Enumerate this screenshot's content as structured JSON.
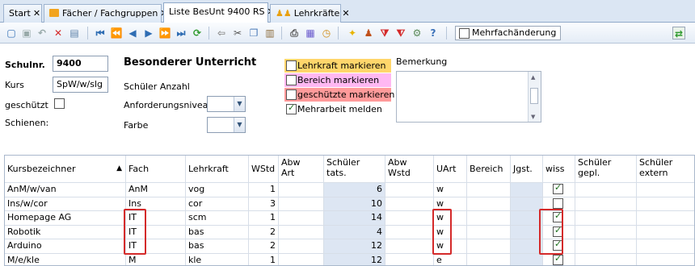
{
  "tabs": [
    {
      "label": "Start"
    },
    {
      "label": "Fächer / Fachgruppen"
    },
    {
      "label": "Liste BesUnt 9400 RS"
    },
    {
      "label": "Lehrkräfte"
    }
  ],
  "toolbar": {
    "mehrfach_label": "Mehrfachänderung"
  },
  "form": {
    "schulnr_label": "Schulnr.",
    "schulnr_value": "9400",
    "kurs_label": "Kurs",
    "kurs_value": "SpW/w/slg",
    "geschuetzt_label": "geschützt",
    "schienen_label": "Schienen:",
    "title": "Besonderer Unterricht",
    "schueler_anzahl_label": "Schüler Anzahl",
    "anforderung_label": "Anforderungsniveau",
    "farbe_label": "Farbe",
    "lehrkraft_markieren": "Lehrkraft markieren",
    "bereich_markieren": "Bereich markieren",
    "geschuetzte_markieren": "geschützte markieren",
    "mehrarbeit_melden": "Mehrarbeit melden",
    "bemerkung_label": "Bemerkung",
    "colors": {
      "lehrkraft": "#ffd66b",
      "bereich": "#ffb8f2",
      "geschuetzt": "#ff9a9a"
    }
  },
  "table": {
    "headers": {
      "kurs": "Kursbezeichner",
      "fach": "Fach",
      "lehrkraft": "Lehrkraft",
      "wstd": "WStd",
      "abwart1": "Abw",
      "abwart2": "Art",
      "schueler1": "Schüler",
      "schueler2": "tats.",
      "abwwstd1": "Abw",
      "abwwstd2": "Wstd",
      "uart": "UArt",
      "bereich": "Bereich",
      "jgst": "Jgst.",
      "wiss": "wiss",
      "gepl1": "Schüler",
      "gepl2": "gepl.",
      "extern1": "Schüler",
      "extern2": "extern"
    },
    "rows": [
      {
        "kurs": "AnM/w/van",
        "fach": "AnM",
        "lehrkraft": "vog",
        "wstd": "1",
        "schueler": "6",
        "uart": "w",
        "wiss": true
      },
      {
        "kurs": "Ins/w/cor",
        "fach": "Ins",
        "lehrkraft": "cor",
        "wstd": "3",
        "schueler": "10",
        "uart": "w",
        "wiss": false
      },
      {
        "kurs": "Homepage AG",
        "fach": "IT",
        "lehrkraft": "scm",
        "wstd": "1",
        "schueler": "14",
        "uart": "w",
        "wiss": true
      },
      {
        "kurs": "Robotik",
        "fach": "IT",
        "lehrkraft": "bas",
        "wstd": "2",
        "schueler": "4",
        "uart": "w",
        "wiss": true
      },
      {
        "kurs": "Arduino",
        "fach": "IT",
        "lehrkraft": "bas",
        "wstd": "2",
        "schueler": "12",
        "uart": "w",
        "wiss": true
      },
      {
        "kurs": "M/e/kle",
        "fach": "M",
        "lehrkraft": "kle",
        "wstd": "1",
        "schueler": "12",
        "uart": "e",
        "wiss": true
      }
    ]
  }
}
